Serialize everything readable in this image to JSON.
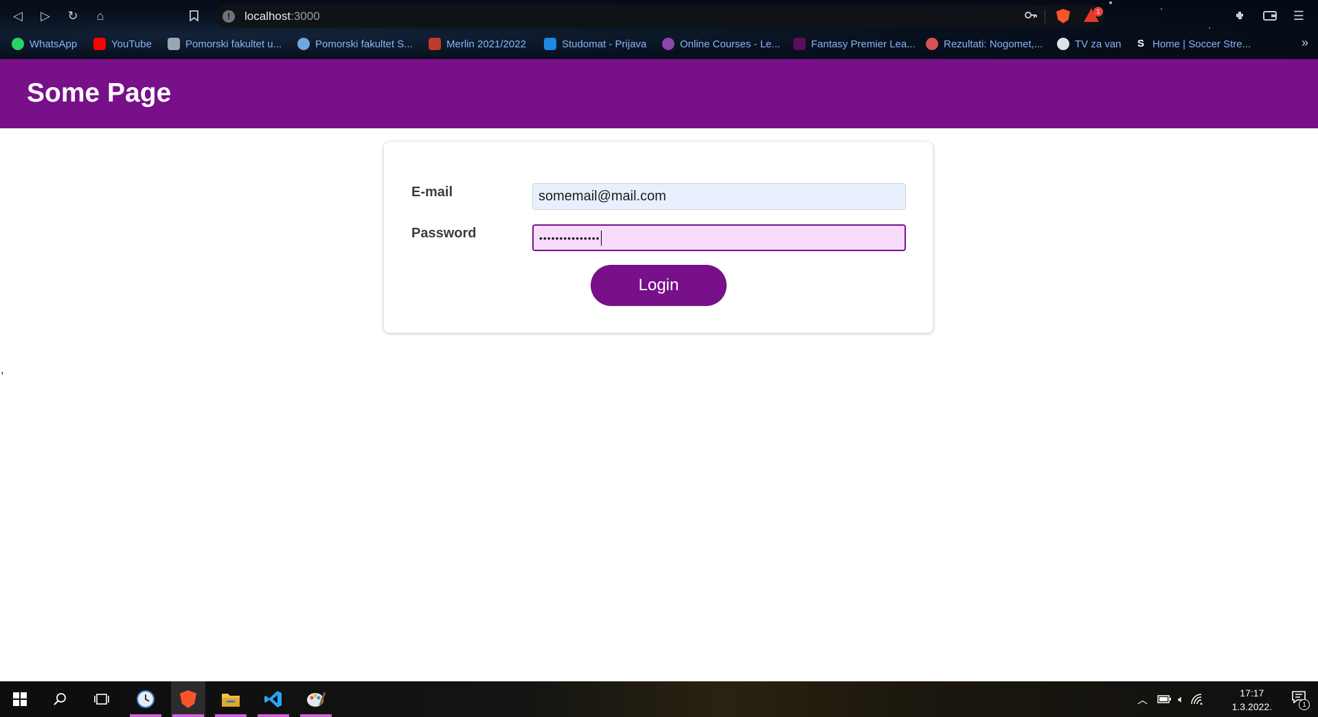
{
  "browser": {
    "url_host": "localhost",
    "url_port": ":3000",
    "rewards_badge": "1",
    "icons": [
      "back-icon",
      "forward-icon",
      "reload-icon",
      "home-icon",
      "bookmark-icon",
      "info-icon",
      "key-icon",
      "brave-shields-icon",
      "brave-rewards-icon",
      "extensions-icon",
      "wallet-icon",
      "menu-icon"
    ],
    "bookmarks": [
      {
        "label": "WhatsApp",
        "color": "#25d366"
      },
      {
        "label": "YouTube",
        "color": "#ff0000"
      },
      {
        "label": "Pomorski fakultet u...",
        "color": "#9aa6b2"
      },
      {
        "label": "Pomorski fakultet S...",
        "color": "#6fa8dc"
      },
      {
        "label": "Merlin 2021/2022",
        "color": "#c0392b"
      },
      {
        "label": "Studomat - Prijava",
        "color": "#1e88e5"
      },
      {
        "label": "Online Courses - Le...",
        "color": "#8e44ad"
      },
      {
        "label": "Fantasy Premier Lea...",
        "color": "#5b0e5f"
      },
      {
        "label": "Rezultati: Nogomet,...",
        "color": "#d35454"
      },
      {
        "label": "TV za van",
        "color": "#dfe3e8"
      },
      {
        "label": "Home | Soccer Stre...",
        "color": "#ffffff"
      }
    ],
    "bookmarks_more": "»"
  },
  "page": {
    "title": "Some Page",
    "email_label": "E-mail",
    "email_value": "somemail@mail.com",
    "password_label": "Password",
    "password_masked": "•••••••••••••••",
    "login_button": "Login",
    "stray_text": ","
  },
  "taskbar": {
    "time": "17:17",
    "date": "1.3.2022.",
    "notification_count": "1",
    "accent": "#d061d6"
  }
}
